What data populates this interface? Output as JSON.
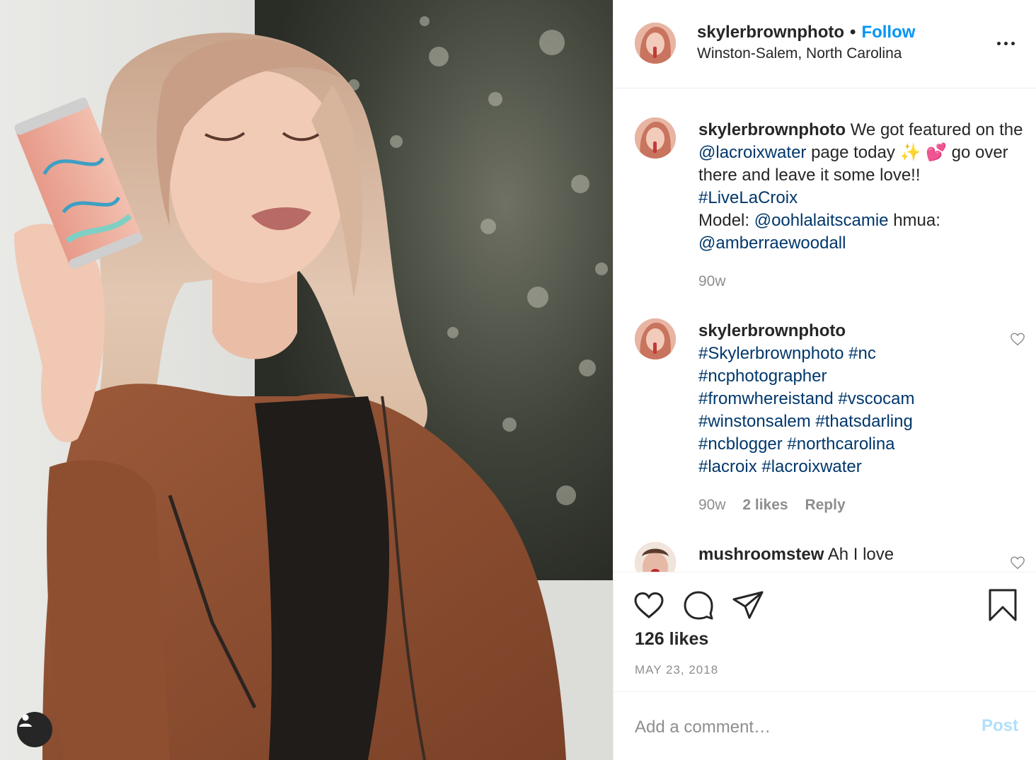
{
  "header": {
    "username": "skylerbrownphoto",
    "separator": "•",
    "follow_label": "Follow",
    "location": "Winston-Salem, North Carolina",
    "more_icon": "more-horizontal-icon"
  },
  "caption": {
    "username": "skylerbrownphoto",
    "text_1": "We got featured on the",
    "mention_1": "@lacroixwater",
    "text_2": "page today ✨ 💕 go over there and leave it some love!!",
    "hashtag": "#LiveLaCroix",
    "text_3": "Model:",
    "mention_2": "@oohlalaitscamie",
    "text_4": "hmua:",
    "mention_3": "@amberraewoodall",
    "time": "90w"
  },
  "comments": [
    {
      "username": "skylerbrownphoto",
      "hashtags": "#Skylerbrownphoto #nc #ncphotographer #fromwhereistand #vscocam #winstonsalem #thatsdarling #ncblogger #northcarolina #lacroix #lacroixwater",
      "time": "90w",
      "likes": "2 likes",
      "reply": "Reply"
    },
    {
      "username": "mushroomstew",
      "text": "Ah I love"
    }
  ],
  "actions": {
    "like_icon": "heart-icon",
    "comment_icon": "comment-icon",
    "share_icon": "paper-plane-icon",
    "save_icon": "bookmark-icon",
    "likes": "126 likes",
    "date": "MAY 23, 2018"
  },
  "add_comment": {
    "placeholder": "Add a comment…",
    "post_label": "Post"
  },
  "colors": {
    "follow": "#0095f6",
    "link": "#00376b",
    "muted": "#8e8e8e",
    "post_disabled": "#b2dffc"
  }
}
